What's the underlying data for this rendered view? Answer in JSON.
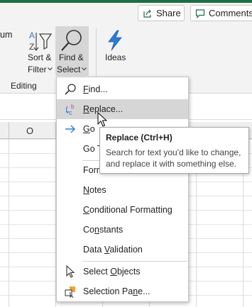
{
  "header": {
    "share_label": "Share",
    "comments_label": "Comments"
  },
  "ribbon": {
    "partial_sum_label": "um",
    "sort_filter": {
      "line1": "Sort &",
      "line2": "Filter"
    },
    "find_select": {
      "line1": "Find &",
      "line2": "Select"
    },
    "ideas_label": "Ideas",
    "group_editing": "Editing"
  },
  "grid": {
    "column_header": "O"
  },
  "menu": {
    "items": [
      {
        "pre": "",
        "u": "F",
        "post": "ind...",
        "icon": "search-icon"
      },
      {
        "pre": "",
        "u": "R",
        "post": "eplace...",
        "icon": "replace-icon"
      },
      {
        "pre": "",
        "u": "G",
        "post": "o",
        "icon": "arrow-right-icon"
      },
      {
        "pre": "Go T",
        "u": "",
        "post": "",
        "icon": ""
      },
      {
        "pre": "Form",
        "u": "",
        "post": "",
        "icon": ""
      },
      {
        "pre": "",
        "u": "N",
        "post": "otes",
        "icon": ""
      },
      {
        "pre": "",
        "u": "C",
        "post": "onditional Formatting",
        "icon": ""
      },
      {
        "pre": "Co",
        "u": "n",
        "post": "stants",
        "icon": ""
      },
      {
        "pre": "Data ",
        "u": "V",
        "post": "alidation",
        "icon": ""
      },
      {
        "pre": "Select ",
        "u": "O",
        "post": "bjects",
        "icon": "select-objects-icon"
      },
      {
        "pre": "Selection Pa",
        "u": "n",
        "post": "e...",
        "icon": "selection-pane-icon"
      }
    ]
  },
  "tooltip": {
    "title": "Replace (Ctrl+H)",
    "description_line1": "Search for text you'd like to change,",
    "description_line2": "and replace it with something else."
  },
  "colors": {
    "title_bar": "#1e6e43",
    "ribbon_bg": "#f3f3f3",
    "hover_bg": "#d6d6d6",
    "icon_blue": "#2b7cd3"
  }
}
